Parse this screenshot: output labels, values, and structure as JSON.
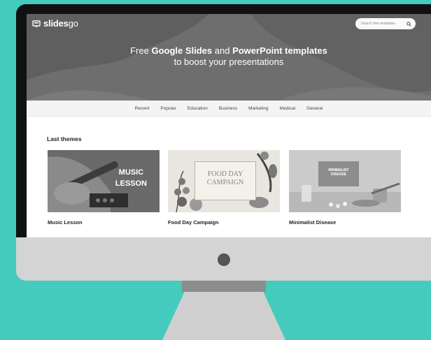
{
  "brand": {
    "logo_main": "slides",
    "logo_suffix": "go"
  },
  "search": {
    "placeholder": "Search free templates"
  },
  "hero": {
    "line1_prefix": "Free ",
    "line1_bold1": "Google Slides",
    "line1_mid": " and ",
    "line1_bold2": "PowerPoint templates",
    "line2": "to boost your presentations"
  },
  "nav": {
    "items": [
      "Recent",
      "Popular",
      "Education",
      "Business",
      "Marketing",
      "Medical",
      "General"
    ]
  },
  "section": {
    "title": "Last themes"
  },
  "cards": [
    {
      "title": "Music Lesson",
      "thumb_line1": "MUSIC",
      "thumb_line2": "LESSON"
    },
    {
      "title": "Food Day Campaign",
      "thumb_line1": "FOOD DAY",
      "thumb_line2": "CAMPAIGN"
    },
    {
      "title": "Minimalist Disease",
      "thumb_line1": "MINIMALIST",
      "thumb_line2": "DISEASE"
    }
  ],
  "colors": {
    "background": "#44cbbd",
    "monitor_bezel": "#111111",
    "monitor_chin": "#d4d4d4"
  }
}
